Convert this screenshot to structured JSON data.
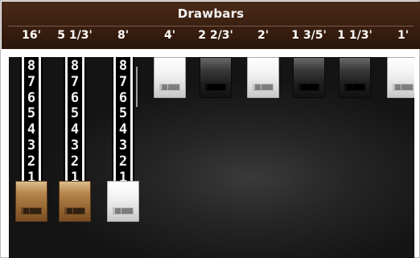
{
  "header": {
    "title": "Drawbars"
  },
  "scale_digits": [
    "8",
    "7",
    "6",
    "5",
    "4",
    "3",
    "2",
    "1"
  ],
  "colors": {
    "header": "#3a1f10",
    "brown_drawbar": "#9a6a36",
    "white_drawbar": "#f2f2f2",
    "black_drawbar": "#2a2a2a"
  },
  "drawbars": [
    {
      "footage": "16'",
      "color": "brown",
      "setting": 8
    },
    {
      "footage": "5 1/3'",
      "color": "brown",
      "setting": 8
    },
    {
      "footage": "8'",
      "color": "white",
      "setting": 8
    },
    {
      "footage": "4'",
      "color": "white",
      "setting": 0
    },
    {
      "footage": "2 2/3'",
      "color": "black",
      "setting": 0
    },
    {
      "footage": "2'",
      "color": "white",
      "setting": 0
    },
    {
      "footage": "1 3/5'",
      "color": "black",
      "setting": 0
    },
    {
      "footage": "1 1/3'",
      "color": "black",
      "setting": 0
    },
    {
      "footage": "1'",
      "color": "white",
      "setting": 0
    }
  ]
}
